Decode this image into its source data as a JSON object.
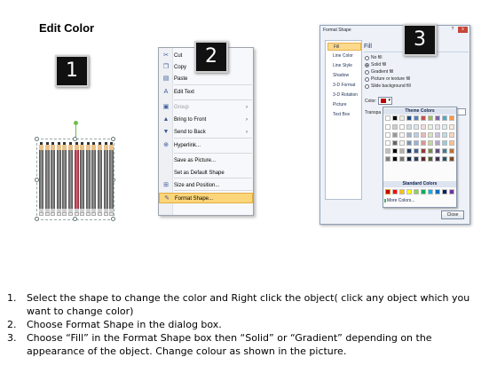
{
  "title": "Edit Color",
  "step_badges": [
    "1",
    "2",
    "3"
  ],
  "context_menu": {
    "items": [
      {
        "label": "Cut",
        "icon": "scissors-icon",
        "enabled": true
      },
      {
        "label": "Copy",
        "icon": "copy-icon",
        "enabled": true
      },
      {
        "label": "Paste",
        "icon": "paste-icon",
        "enabled": true
      },
      {
        "label": "Edit Text",
        "icon": "edit-text-icon",
        "enabled": true
      },
      {
        "label": "Group",
        "icon": "group-icon",
        "enabled": false,
        "submenu": true
      },
      {
        "label": "Bring to Front",
        "icon": "bring-to-front-icon",
        "enabled": true,
        "submenu": true
      },
      {
        "label": "Send to Back",
        "icon": "send-to-back-icon",
        "enabled": true,
        "submenu": true
      },
      {
        "label": "Hyperlink...",
        "icon": "hyperlink-icon",
        "enabled": true
      },
      {
        "label": "Save as Picture...",
        "icon": "",
        "enabled": true
      },
      {
        "label": "Set as Default Shape",
        "icon": "",
        "enabled": true
      },
      {
        "label": "Size and Position...",
        "icon": "size-position-icon",
        "enabled": true
      },
      {
        "label": "Format Shape...",
        "icon": "format-shape-icon",
        "enabled": true,
        "highlighted": true
      }
    ]
  },
  "format_dialog": {
    "title": "Format Shape",
    "help": "?",
    "close_x": "x",
    "nav": [
      "Fill",
      "Line Color",
      "Line Style",
      "Shadow",
      "3-D Format",
      "3-D Rotation",
      "Picture",
      "Text Box"
    ],
    "selected_nav": "Fill",
    "section_title": "Fill",
    "options": [
      {
        "label": "No fill",
        "checked": false
      },
      {
        "label": "Solid fill",
        "checked": true
      },
      {
        "label": "Gradient fill",
        "checked": false
      },
      {
        "label": "Picture or texture fill",
        "checked": false
      },
      {
        "label": "Slide background fill",
        "checked": false
      }
    ],
    "color_label": "Color:",
    "transparency_label": "Transpa",
    "theme_colors_label": "Theme Colors",
    "standard_colors_label": "Standard Colors",
    "more_colors_label": "More Colors...",
    "close_button": "Close",
    "theme_top_row": [
      "#ffffff",
      "#000000",
      "#eeece1",
      "#1f497d",
      "#4f81bd",
      "#c0504d",
      "#9bbb59",
      "#8064a2",
      "#4bacc6",
      "#f79646"
    ],
    "standard_colors": [
      "#c00000",
      "#ff0000",
      "#ffc000",
      "#ffff00",
      "#92d050",
      "#00b050",
      "#00b0f0",
      "#0070c0",
      "#002060",
      "#7030a0"
    ],
    "selected_color": "#c00000"
  },
  "instructions": [
    {
      "num": "1.",
      "text": "Select the shape to change the color and Right click the object( click any object which you want to change color)"
    },
    {
      "num": "2.",
      "text": "Choose Format Shape in the dialog box."
    },
    {
      "num": "3.",
      "text": "Choose “Fill” in the Format Shape box then “Solid” or “Gradient” depending on the appearance of the object. Change colour as shown in the picture."
    }
  ]
}
